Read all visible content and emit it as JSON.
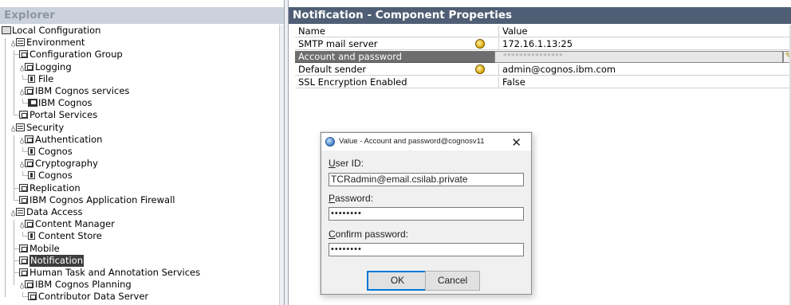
{
  "explorer": {
    "title": "Explorer",
    "tree": [
      {
        "label": "Local Configuration",
        "icon": "local-config-icon",
        "toggle": ""
      },
      {
        "label": "Environment",
        "icon": "folder-icon",
        "toggle": "collapse"
      },
      {
        "label": "Configuration Group",
        "icon": "component-icon",
        "toggle": ""
      },
      {
        "label": "Logging",
        "icon": "component-icon",
        "toggle": "collapse"
      },
      {
        "label": "File",
        "icon": "resource-icon",
        "toggle": ""
      },
      {
        "label": "IBM Cognos services",
        "icon": "component-icon",
        "toggle": "collapse"
      },
      {
        "label": "IBM Cognos",
        "icon": "service-icon",
        "toggle": ""
      },
      {
        "label": "Portal Services",
        "icon": "component-icon",
        "toggle": ""
      },
      {
        "label": "Security",
        "icon": "folder-icon",
        "toggle": "collapse"
      },
      {
        "label": "Authentication",
        "icon": "component-icon",
        "toggle": "collapse"
      },
      {
        "label": "Cognos",
        "icon": "resource-icon",
        "toggle": ""
      },
      {
        "label": "Cryptography",
        "icon": "component-icon",
        "toggle": "collapse"
      },
      {
        "label": "Cognos",
        "icon": "resource-icon",
        "toggle": ""
      },
      {
        "label": "Replication",
        "icon": "component-icon",
        "toggle": ""
      },
      {
        "label": "IBM Cognos Application Firewall",
        "icon": "component-icon",
        "toggle": ""
      },
      {
        "label": "Data Access",
        "icon": "folder-icon",
        "toggle": "collapse"
      },
      {
        "label": "Content Manager",
        "icon": "component-icon",
        "toggle": "collapse"
      },
      {
        "label": "Content Store",
        "icon": "resource-icon",
        "toggle": ""
      },
      {
        "label": "Mobile",
        "icon": "component-icon",
        "toggle": ""
      },
      {
        "label": "Notification",
        "icon": "component-icon",
        "toggle": "",
        "selected": true
      },
      {
        "label": "Human Task and Annotation Services",
        "icon": "component-icon",
        "toggle": ""
      },
      {
        "label": "IBM Cognos Planning",
        "icon": "component-icon",
        "toggle": "collapse"
      },
      {
        "label": "Contributor Data Server",
        "icon": "component-icon",
        "toggle": ""
      }
    ]
  },
  "properties": {
    "title": "Notification - Component Properties",
    "columns": [
      "Name",
      "Value"
    ],
    "rows": [
      {
        "name": "SMTP mail server",
        "value": "172.16.1.13:25",
        "has_icon": true
      },
      {
        "name": "Account and password",
        "value": "***************",
        "selected": true
      },
      {
        "name": "Default sender",
        "value": "admin@cognos.ibm.com",
        "has_icon": true
      },
      {
        "name": "SSL Encryption Enabled",
        "value": "False"
      }
    ]
  },
  "dialog": {
    "title": "Value - Account and password@cognosv11",
    "close": "✕",
    "user_id_label_u": "U",
    "user_id_label_rest": "ser ID:",
    "user_id_value": "TCRadmin@email.csilab.private",
    "password_label_u": "P",
    "password_label_rest": "assword:",
    "password_value": "••••••••",
    "confirm_label_u": "C",
    "confirm_label_rest": "onfirm password:",
    "confirm_value": "••••••••",
    "ok": "OK",
    "cancel": "Cancel"
  }
}
